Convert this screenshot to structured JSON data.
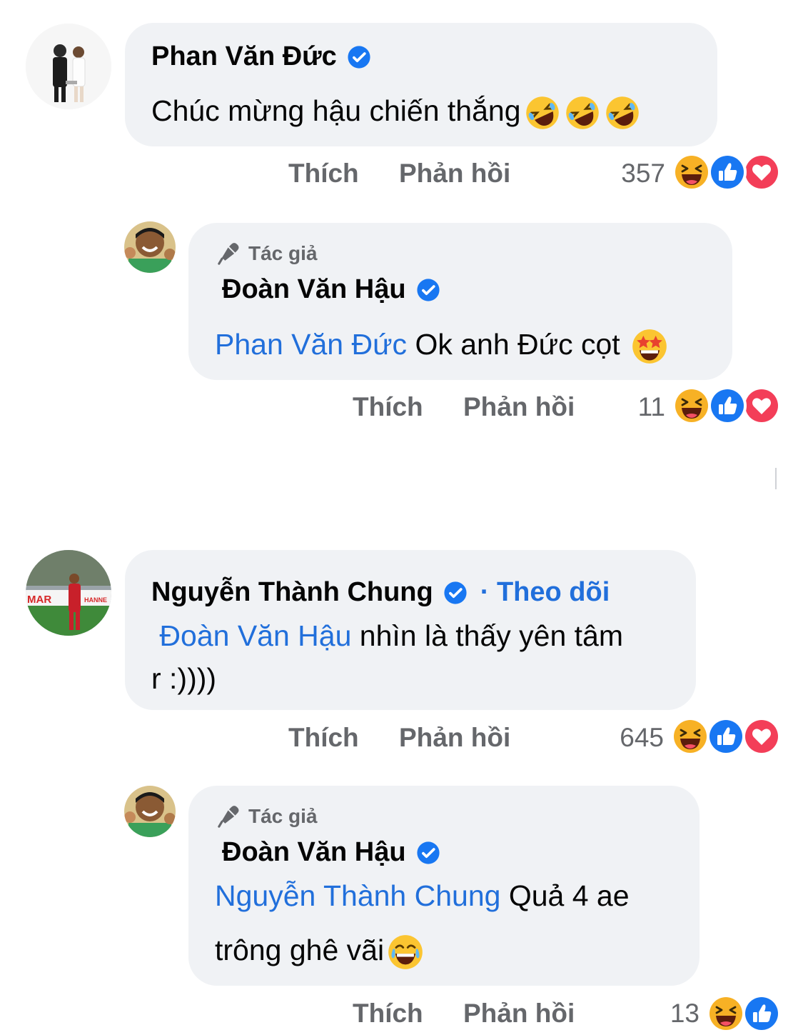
{
  "comments": [
    {
      "author": "Phan Văn Đức",
      "text": "Chúc mừng hậu chiến thắng",
      "like_label": "Thích",
      "reply_label": "Phản hồi",
      "reaction_count": "357"
    },
    {
      "author_tag": "Tác giả",
      "author": "Đoàn Văn Hậu",
      "mention": "Phan Văn Đức",
      "text": " Ok anh Đức cọt ",
      "like_label": "Thích",
      "reply_label": "Phản hồi",
      "reaction_count": "11"
    },
    {
      "author": "Nguyễn Thành Chung",
      "follow_label": "· Theo dõi",
      "mention": "Đoàn Văn Hậu",
      "text_line1": " nhìn là thấy yên tâm",
      "text_line2": "r :))))",
      "like_label": "Thích",
      "reply_label": "Phản hồi",
      "reaction_count": "645"
    },
    {
      "author_tag": "Tác giả",
      "author": "Đoàn Văn Hậu",
      "mention": "Nguyễn Thành Chung",
      "text_line1": " Quả 4 ae",
      "text_line2": "trông ghê vãi",
      "like_label": "Thích",
      "reply_label": "Phản hồi",
      "reaction_count": "13"
    }
  ],
  "icons": {
    "verified": "verified-badge-icon",
    "author": "microphone-icon",
    "reactions": [
      "haha-reaction-icon",
      "like-reaction-icon",
      "love-reaction-icon"
    ]
  },
  "colors": {
    "bubble": "#f0f2f5",
    "mention": "#216fdb",
    "verified": "#1877f2",
    "like": "#1877f2",
    "love": "#f33e58",
    "haha": "#f7b125",
    "muted": "#65676b"
  }
}
